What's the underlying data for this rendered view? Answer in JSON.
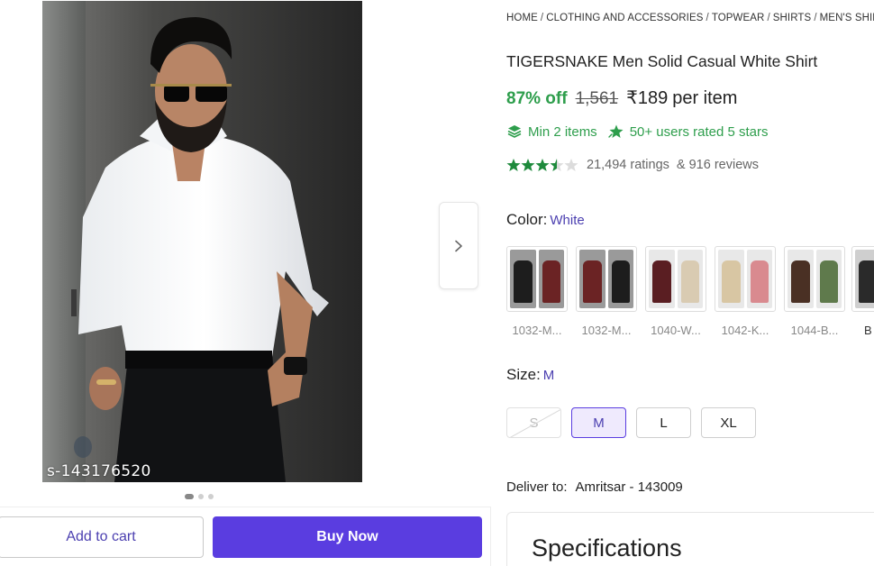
{
  "product_image": {
    "code_overlay": "s-143176520",
    "carousel": {
      "count": 3,
      "active_index": 0
    }
  },
  "actions": {
    "add_to_cart_label": "Add to cart",
    "buy_now_label": "Buy Now"
  },
  "breadcrumb": [
    "HOME",
    "CLOTHING AND ACCESSORIES",
    "TOPWEAR",
    "SHIRTS",
    "MEN'S SHIRTS"
  ],
  "breadcrumb_separator": "/",
  "product": {
    "title": "TIGERSNAKE Men Solid Casual White Shirt",
    "discount": "87% off",
    "mrp": "1,561",
    "price": "₹189",
    "price_unit": "per item"
  },
  "offers": {
    "min_items": "Min 2 items",
    "users_rated": "50+ users rated 5 stars"
  },
  "rating": {
    "stars": 3.5,
    "ratings_text": "21,494 ratings",
    "reviews_text": "& 916 reviews"
  },
  "color": {
    "label": "Color:",
    "selected": "White",
    "options": [
      {
        "caption": "1032-M...",
        "colors": [
          "#1d1d1d",
          "#6b2324"
        ]
      },
      {
        "caption": "1032-M...",
        "colors": [
          "#6b2324",
          "#1d1d1d"
        ]
      },
      {
        "caption": "1040-W...",
        "colors": [
          "#5a1e22",
          "#d9cbb2"
        ]
      },
      {
        "caption": "1042-K...",
        "colors": [
          "#d8c6a3",
          "#d98a8f"
        ]
      },
      {
        "caption": "1044-B...",
        "colors": [
          "#4a3024",
          "#5f7a4c"
        ]
      },
      {
        "caption": "B",
        "colors": [
          "#2a2a2a",
          "#bdbdbd"
        ]
      }
    ]
  },
  "size": {
    "label": "Size:",
    "selected": "M",
    "options": [
      {
        "label": "S",
        "state": "disabled"
      },
      {
        "label": "M",
        "state": "selected"
      },
      {
        "label": "L",
        "state": "default"
      },
      {
        "label": "XL",
        "state": "default"
      }
    ]
  },
  "delivery": {
    "label": "Deliver to:",
    "location": "Amritsar - 143009"
  },
  "specifications": {
    "title": "Specifications"
  },
  "icons": {
    "next": "chevron-right-icon",
    "min_items": "layers-icon",
    "users_rated": "star-badge-icon",
    "star": "star-icon"
  },
  "theme": {
    "accent": "#5a3de0",
    "accent_text": "#4b3fb0",
    "discount_green": "#2e9e4c",
    "star_green": "#1e8a3c"
  }
}
